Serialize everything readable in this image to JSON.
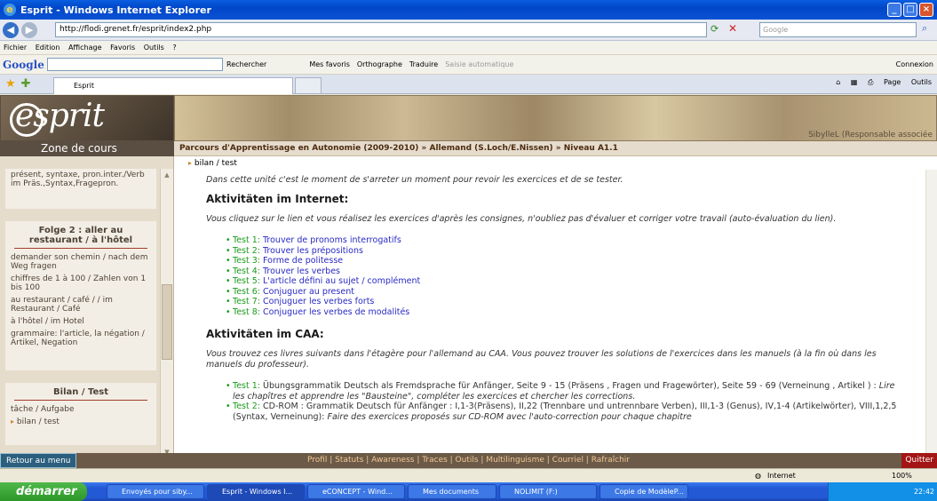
{
  "window": {
    "title": "Esprit - Windows Internet Explorer"
  },
  "address": {
    "url": "http://flodi.grenet.fr/esprit/index2.php",
    "search_placeholder": "Google"
  },
  "menu": [
    "Fichier",
    "Edition",
    "Affichage",
    "Favoris",
    "Outils",
    "?"
  ],
  "googlebar": {
    "logo": "Google",
    "items": [
      "Rechercher",
      "Mes favoris",
      "Orthographe",
      "Traduire",
      "Saisie automatique"
    ],
    "connexion": "Connexion"
  },
  "tabs": {
    "active": "Esprit",
    "tools": [
      "Page",
      "Outils"
    ]
  },
  "site": {
    "logo": "esprit",
    "zone": "Zone de cours",
    "signed_in": "SibylleL (Responsable associée",
    "breadcrumb": "Parcours d'Apprentissage en Autonomie (2009-2010) » Allemand (S.Loch/E.Nissen) » Niveau A1.1",
    "sub_breadcrumb": "bilan / test"
  },
  "sidebar": {
    "top_items": [
      "présent, syntaxe, pron.inter./Verb im Präs.,Syntax,Fragepron."
    ],
    "folge2": {
      "title": "Folge 2 : aller au restaurant / à l'hôtel",
      "items": [
        "demander son chemin / nach dem Weg fragen",
        "chiffres de 1 à 100 / Zahlen von 1 bis 100",
        "au restaurant / café / / im Restaurant / Café",
        "à l'hôtel / im Hotel",
        "grammaire: l'article, la négation / Artikel, Negation"
      ]
    },
    "bilan": {
      "title": "Bilan / Test",
      "items": [
        "tâche / Aufgabe",
        "bilan / test"
      ]
    }
  },
  "content": {
    "intro": "Dans cette unité c'est le moment de s'arreter un moment pour revoir les exercices et de se tester.",
    "h_internet": "Aktivitäten im Internet:",
    "internet_text": "Vous cliquez sur le lien et vous réalisez les exercices d'après les consignes, n'oubliez pas d'évaluer et corriger votre travail (auto-évaluation du lien).",
    "tests": [
      {
        "label": "Test 1:",
        "text": "Trouver de pronoms interrogatifs"
      },
      {
        "label": "Test 2:",
        "text": "Trouver les prépositions"
      },
      {
        "label": "Test 3:",
        "text": "Forme de politesse"
      },
      {
        "label": "Test 4:",
        "text": "Trouver les verbes"
      },
      {
        "label": "Test 5:",
        "text": "L'article défini au sujet / complément"
      },
      {
        "label": "Test 6:",
        "text": "Conjuguer au present"
      },
      {
        "label": "Test 7:",
        "text": "Conjuguer les verbes forts"
      },
      {
        "label": "Test 8:",
        "text": "Conjuguer les verbes de modalités"
      }
    ],
    "h_caa": "Aktivitäten im CAA:",
    "caa_text": "Vous trouvez ces livres suivants dans l'étagère pour l'allemand au CAA. Vous pouvez trouver les solutions de l'exercices dans les manuels (à la fin où dans les manuels du professeur).",
    "caa": [
      {
        "label": "Test 1:",
        "text": "Übungsgrammatik Deutsch als Fremdsprache für Anfänger, Seite 9 - 15 (Präsens , Fragen und Fragewörter), Seite 59 - 69 (Verneinung , Artikel ) :",
        "italic": "Lire les chapîtres et apprendre les \"Bausteine\", compléter les exercices et chercher les corrections."
      },
      {
        "label": "Test 2:",
        "text": "CD-ROM : Grammatik Deutsch für Anfänger : I,1-3(Präsens), II,22 (Trennbare und untrennbare Verben), III,1-3 (Genus), IV,1-4 (Artikelwörter), VIII,1,2,5 (Syntax, Verneinung):",
        "italic": "Faire des exercices proposés sur CD-ROM avec l'auto-correction pour chaque chapitre"
      }
    ]
  },
  "footer": {
    "left": "Retour au menu",
    "links": "Profil | Statuts | Awareness | Traces | Outils | Multilinguisme | Courriel | Rafraîchir",
    "right": "Quitter"
  },
  "status": {
    "zone": "Internet",
    "zoom": "100%"
  },
  "taskbar": {
    "start": "démarrer",
    "items": [
      "Envoyés pour siby...",
      "Esprit - Windows I...",
      "eCONCEPT - Wind...",
      "Mes documents",
      "NOLIMIT (F:)",
      "Copie de ModèleP..."
    ],
    "clock": "22:42"
  }
}
